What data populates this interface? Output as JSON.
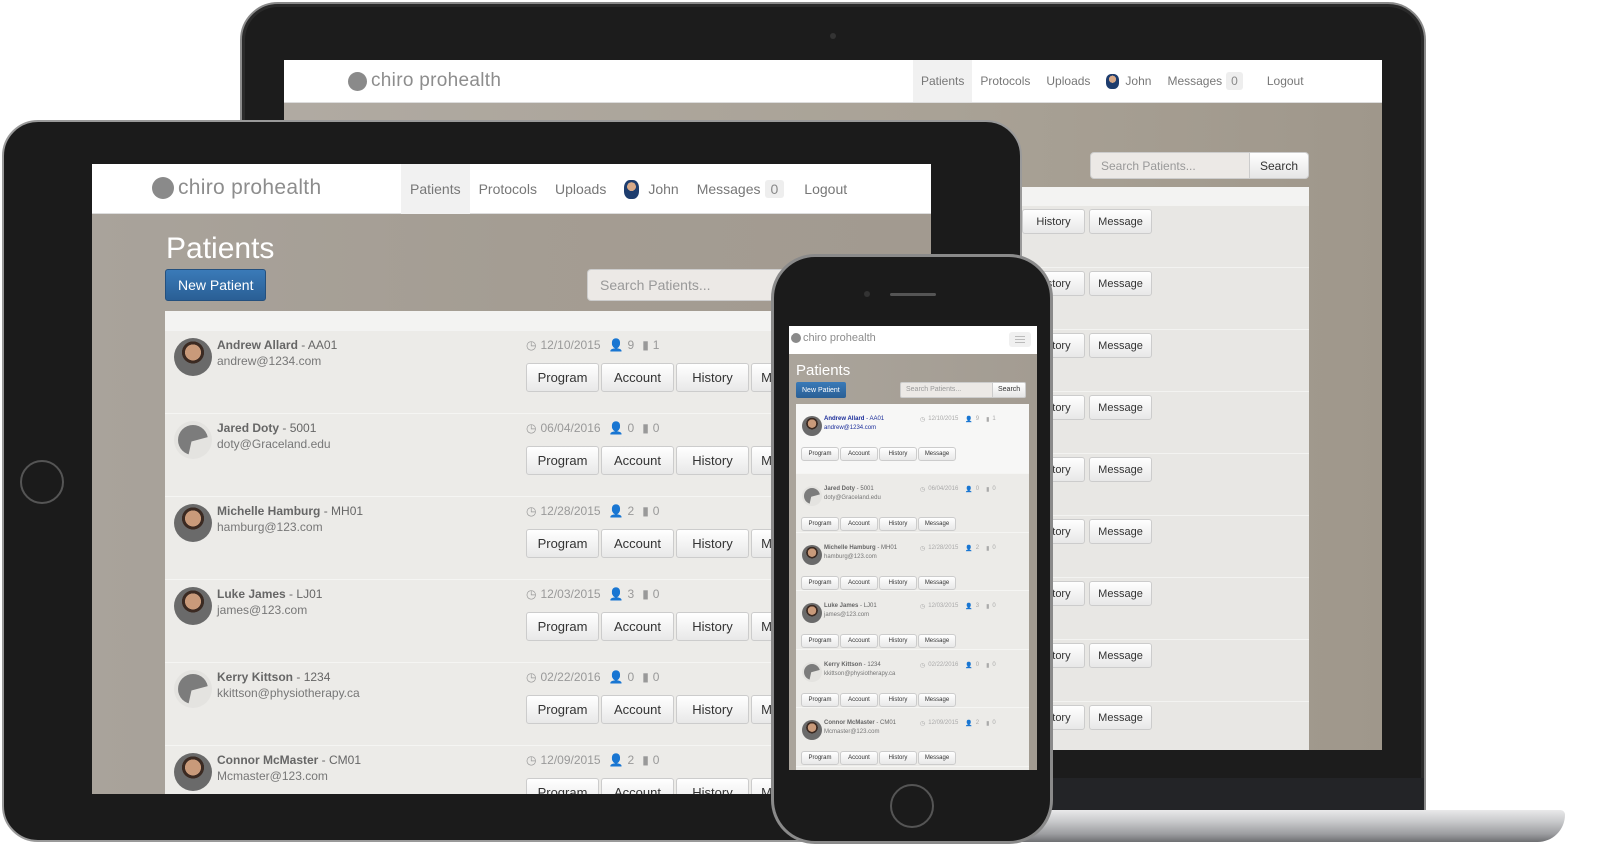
{
  "app": {
    "brand": "chiro prohealth",
    "nav": {
      "items": [
        "Patients",
        "Protocols",
        "Uploads"
      ],
      "active": "Patients",
      "user": "John",
      "messages_label": "Messages",
      "messages_count": "0",
      "logout": "Logout"
    },
    "page_title": "Patients",
    "new_patient_label": "New Patient",
    "search": {
      "placeholder": "Search Patients...",
      "button": "Search"
    },
    "action_buttons": [
      "Program",
      "Account",
      "History",
      "Message"
    ],
    "patients": [
      {
        "name": "Andrew Allard",
        "code": "AA01",
        "email": "andrew@1234.com",
        "date": "12/10/2015",
        "users": "9",
        "videos": "1",
        "avatar": "photo"
      },
      {
        "name": "Jared Doty",
        "code": "5001",
        "email": "doty@Graceland.edu",
        "date": "06/04/2016",
        "users": "0",
        "videos": "0",
        "avatar": "generic"
      },
      {
        "name": "Michelle Hamburg",
        "code": "MH01",
        "email": "hamburg@123.com",
        "date": "12/28/2015",
        "users": "2",
        "videos": "0",
        "avatar": "photo"
      },
      {
        "name": "Luke James",
        "code": "LJ01",
        "email": "james@123.com",
        "date": "12/03/2015",
        "users": "3",
        "videos": "0",
        "avatar": "photo"
      },
      {
        "name": "Kerry Kittson",
        "code": "1234",
        "email": "kkittson@physiotherapy.ca",
        "date": "02/22/2016",
        "users": "0",
        "videos": "0",
        "avatar": "generic"
      },
      {
        "name": "Connor McMaster",
        "code": "CM01",
        "email": "Mcmaster@123.com",
        "date": "12/09/2015",
        "users": "2",
        "videos": "0",
        "avatar": "photo"
      }
    ],
    "colors": {
      "primary_button": "#2f6aa4",
      "page_background": "#a7a097",
      "panel_background": "#ecebe8",
      "nav_text": "#777777"
    }
  }
}
